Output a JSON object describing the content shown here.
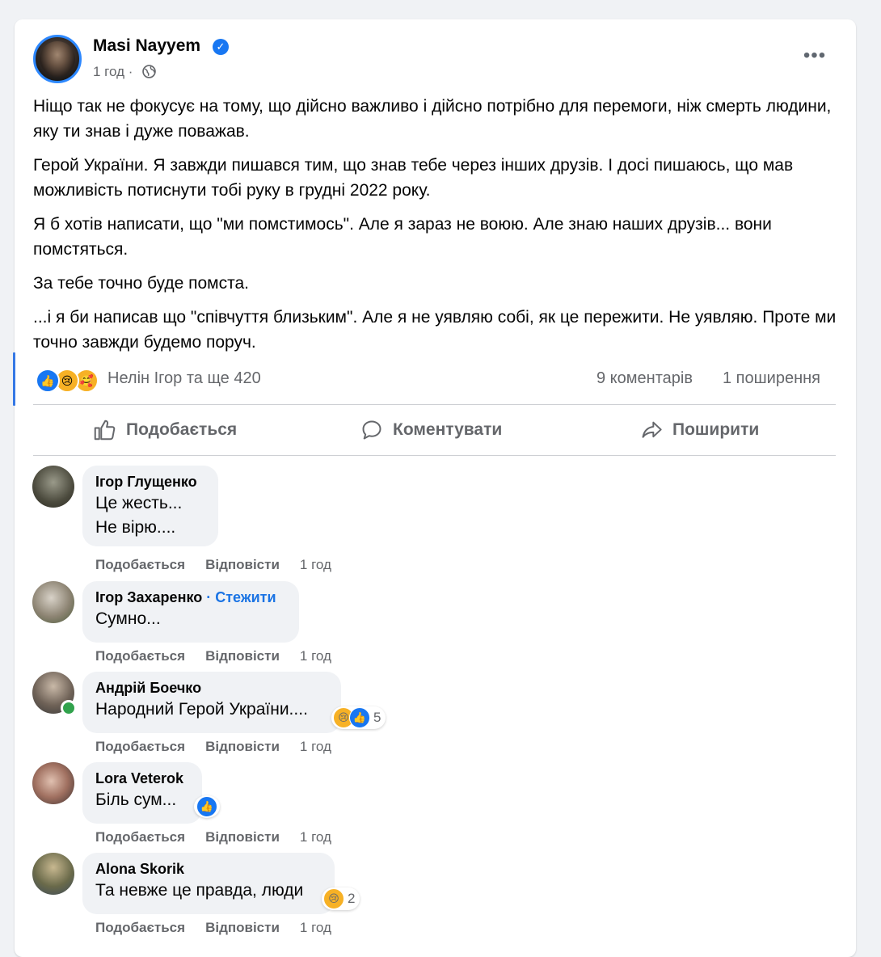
{
  "post": {
    "author": "Masi Nayyem",
    "time": "1 год ·",
    "paragraphs": [
      "Ніщо так не фокусує на тому, що дійсно важливо і дійсно потрібно для перемоги, ніж смерть людини, яку ти знав і дуже поважав.",
      "Герой України. Я завжди пишався тим, що знав тебе через інших друзів. І досі пишаюсь, що мав можливість потиснути тобі руку в грудні 2022 року.",
      "Я б хотів написати, що \"ми помстимось\". Але я зараз не воюю. Але знаю наших друзів... вони помстяться.",
      "За тебе точно буде помста.",
      "...і я би написав що \"співчуття близьким\". Але я не уявляю собі, як це пережити. Не уявляю. Проте ми точно завжди будемо поруч."
    ],
    "reactors": "Нелін Ігор та ще 420",
    "comments_count": "9 коментарів",
    "shares_count": "1 поширення"
  },
  "actions": {
    "like": "Подобається",
    "comment": "Коментувати",
    "share": "Поширити"
  },
  "comments": [
    {
      "name": "Ігор Глущенко",
      "lines": [
        "Це жесть...",
        "Не вірю...."
      ],
      "like": "Подобається",
      "reply": "Відповісти",
      "time": "1 год"
    },
    {
      "name": "Ігор Захаренко",
      "follow": "· Стежити",
      "lines": [
        "Сумно..."
      ],
      "like": "Подобається",
      "reply": "Відповісти",
      "time": "1 год"
    },
    {
      "name": "Андрій Боечко",
      "lines": [
        "Народний Герой України...."
      ],
      "reaction_count": "5",
      "like": "Подобається",
      "reply": "Відповісти",
      "time": "1 год"
    },
    {
      "name": "Lora Veterok",
      "lines": [
        "Біль сум..."
      ],
      "like": "Подобається",
      "reply": "Відповісти",
      "time": "1 год"
    },
    {
      "name": "Alona Skorik",
      "lines": [
        "Та невже це правда, люди"
      ],
      "reaction_count": "2",
      "like": "Подобається",
      "reply": "Відповісти",
      "time": "1 год"
    }
  ],
  "colors": {
    "accent": "#1877f2",
    "secondary_text": "#65676b",
    "bubble": "#f0f2f5"
  }
}
